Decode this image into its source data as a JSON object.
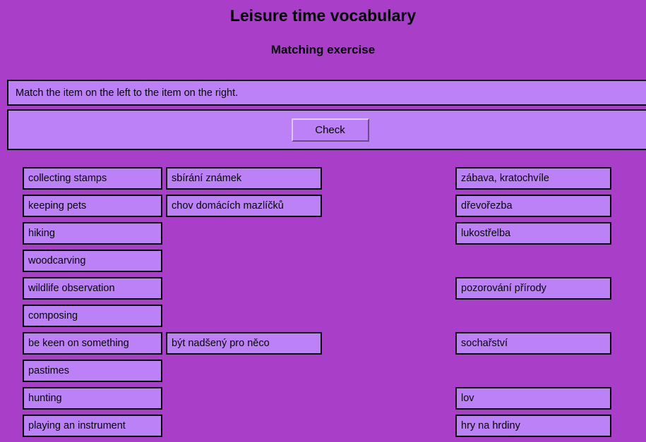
{
  "header": {
    "title": "Leisure time vocabulary",
    "subtitle": "Matching exercise"
  },
  "instructions": {
    "text": "Match the item on the left to the item on the right."
  },
  "toolbar": {
    "check_label": "Check"
  },
  "colors": {
    "page_background": "#a93fc9",
    "box_fill": "#bd81f7",
    "box_border": "#000000",
    "button_highlight": "#e3c7ff",
    "button_shadow": "#6b4a8c"
  },
  "exercise": {
    "rows": [
      {
        "left": "collecting stamps",
        "middle": "sbírání známek",
        "right": "zábava, kratochvíle"
      },
      {
        "left": "keeping pets",
        "middle": "chov domácích mazlíčků",
        "right": "dřevořezba"
      },
      {
        "left": "hiking",
        "middle": "",
        "right": "lukostřelba"
      },
      {
        "left": "woodcarving",
        "middle": "",
        "right": ""
      },
      {
        "left": "wildlife observation",
        "middle": "",
        "right": "pozorování přírody"
      },
      {
        "left": "composing",
        "middle": "",
        "right": ""
      },
      {
        "left": "be keen on something",
        "middle": "být nadšený pro něco",
        "right": "sochařství"
      },
      {
        "left": "pastimes",
        "middle": "",
        "right": ""
      },
      {
        "left": "hunting",
        "middle": "",
        "right": "lov"
      },
      {
        "left": "playing an instrument",
        "middle": "",
        "right": "hry na hrdiny"
      }
    ]
  }
}
